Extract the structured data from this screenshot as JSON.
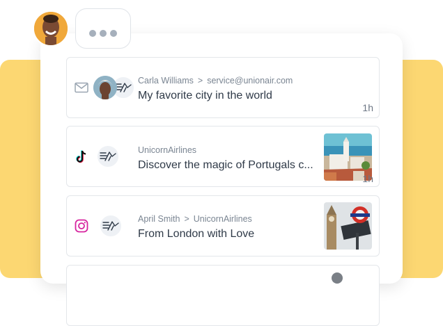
{
  "user": {
    "avatar": "user-avatar"
  },
  "typing": {
    "dots": 3
  },
  "messages": [
    {
      "channel": "mail-icon",
      "sender": "Carla Williams",
      "separator": ">",
      "recipient": "service@unionair.com",
      "subject": "My favorite city in the world",
      "time": "1h"
    },
    {
      "channel": "tiktok-icon",
      "sender": "UnicornAirlines",
      "subject": "Discover the magic of Portugals c...",
      "time": "1h",
      "thumbnail": "portugal-photo"
    },
    {
      "channel": "instagram-icon",
      "sender": "April Smith",
      "separator": ">",
      "recipient": "UnicornAirlines",
      "subject": "From London with Love",
      "thumbnail": "london-photo"
    }
  ],
  "colors": {
    "accent": "#fcd772",
    "instagram": "#d6249f"
  }
}
